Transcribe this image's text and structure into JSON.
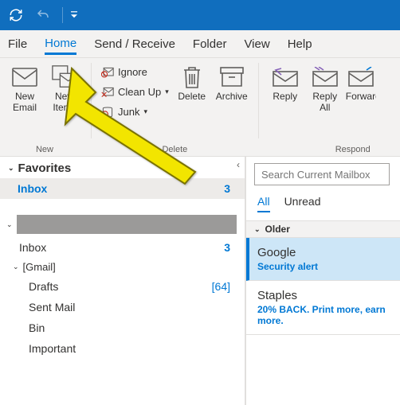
{
  "tabs": {
    "file": "File",
    "home": "Home",
    "sendreceive": "Send / Receive",
    "folder": "Folder",
    "view": "View",
    "help": "Help"
  },
  "ribbon": {
    "new_email": "New\nEmail",
    "new_items": "New\nItems",
    "ignore": "Ignore",
    "cleanup": "Clean Up",
    "junk": "Junk",
    "delete": "Delete",
    "archive": "Archive",
    "reply": "Reply",
    "replyall": "Reply\nAll",
    "forward": "Forward",
    "grp_new": "New",
    "grp_delete": "Delete",
    "grp_respond": "Respond"
  },
  "nav": {
    "favorites": "Favorites",
    "inbox": "Inbox",
    "inbox_count": "3",
    "gmail": "[Gmail]",
    "drafts": "Drafts",
    "drafts_count": "[64]",
    "sentmail": "Sent Mail",
    "bin": "Bin",
    "important": "Important"
  },
  "reading": {
    "search_ph": "Search Current Mailbox",
    "all": "All",
    "unread": "Unread",
    "older": "Older",
    "msg1_sender": "Google",
    "msg1_subj": "Security alert",
    "msg2_sender": "Staples",
    "msg2_subj": "20% BACK. Print more, earn more."
  }
}
